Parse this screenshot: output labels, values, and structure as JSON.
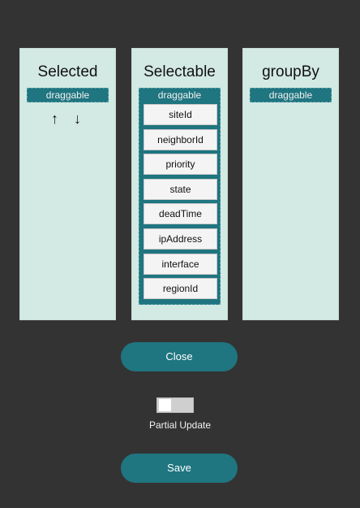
{
  "panels": {
    "selected": {
      "title": "Selected",
      "drag_label": "draggable",
      "arrow_up": "↑",
      "arrow_down": "↓"
    },
    "selectable": {
      "title": "Selectable",
      "drag_label": "draggable",
      "items": [
        "siteId",
        "neighborId",
        "priority",
        "state",
        "deadTime",
        "ipAddress",
        "interface",
        "regionId"
      ]
    },
    "groupby": {
      "title": "groupBy",
      "drag_label": "draggable"
    }
  },
  "buttons": {
    "close_label": "Close",
    "save_label": "Save"
  },
  "toggle": {
    "label": "Partial Update",
    "checked": false
  },
  "colors": {
    "background": "#333333",
    "panel": "#d3e9e3",
    "accent": "#1f7580"
  }
}
